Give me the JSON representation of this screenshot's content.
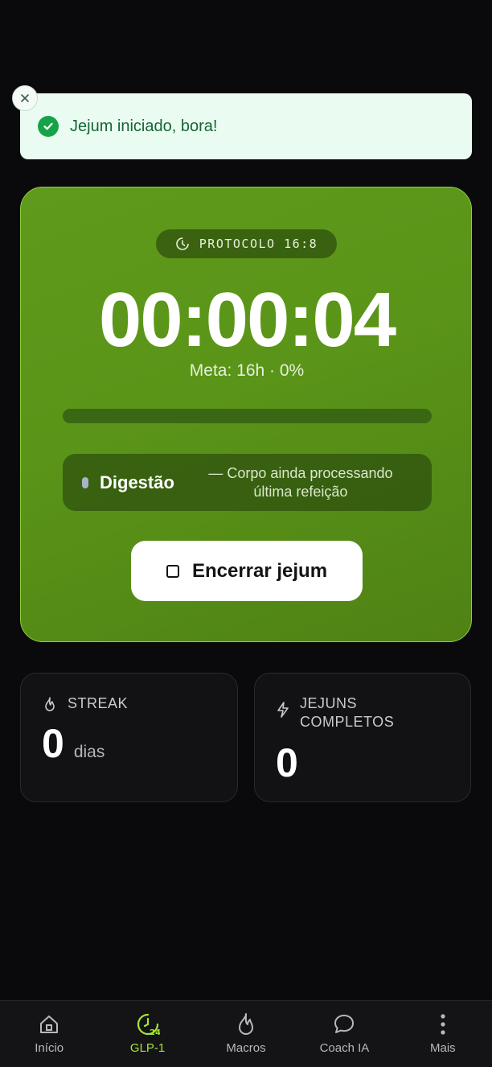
{
  "toast": {
    "message": "Jejum iniciado, bora!"
  },
  "timer": {
    "protocol": "PROTOCOLO 16:8",
    "elapsed": "00:00:04",
    "goal": "Meta: 16h · 0%",
    "progress_percent": 0,
    "phase": {
      "name": "Digestão",
      "description": "— Corpo ainda processando última refeição"
    },
    "end_button": "Encerrar jejum"
  },
  "stats": {
    "streak": {
      "label": "STREAK",
      "value": "0",
      "unit": "dias"
    },
    "completed": {
      "label": "JEJUNS COMPLETOS",
      "value": "0"
    }
  },
  "nav": {
    "items": [
      {
        "label": "Início",
        "icon": "home-icon"
      },
      {
        "label": "GLP-1",
        "icon": "clock-24-icon",
        "active": true
      },
      {
        "label": "Macros",
        "icon": "flame-icon"
      },
      {
        "label": "Coach IA",
        "icon": "chat-bubble-icon"
      },
      {
        "label": "Mais",
        "icon": "more-vertical-icon"
      }
    ]
  },
  "colors": {
    "accent": "#a3e635",
    "card_green": "#5a9418",
    "toast_bg": "#eafbf2",
    "toast_text": "#166534",
    "background": "#0a0a0c"
  }
}
